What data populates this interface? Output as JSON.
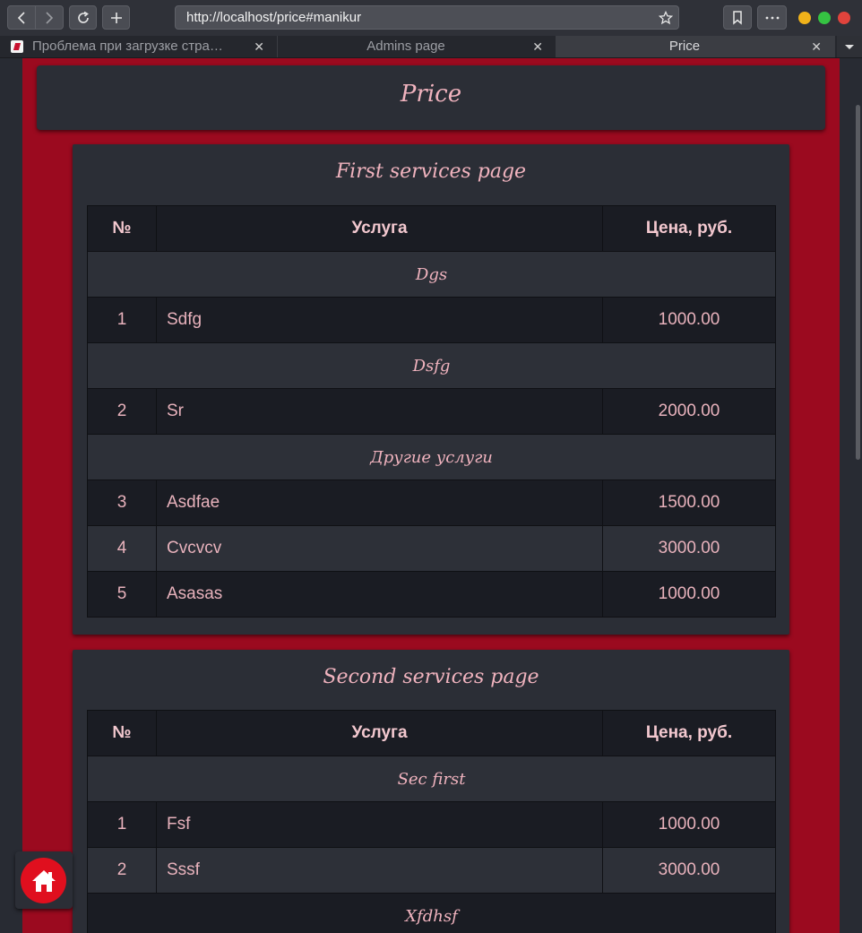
{
  "browser": {
    "url": "http://localhost/price#manikur",
    "tabs": [
      {
        "label": "Проблема при загрузке стра…",
        "close": "✕"
      },
      {
        "label": "Admins page",
        "close": "✕"
      },
      {
        "label": "Price",
        "close": "✕"
      }
    ],
    "window_buttons": {
      "close": "#e0433c",
      "minimize": "#f0b21a",
      "maximize": "#35c342"
    }
  },
  "page": {
    "title": "Price",
    "columns": [
      "№",
      "Услуга",
      "Цена, руб."
    ],
    "sections": [
      {
        "title": "First services page",
        "groups": [
          {
            "name": "Dgs",
            "rows": [
              {
                "num": "1",
                "name": "Sdfg",
                "price": "1000.00"
              }
            ]
          },
          {
            "name": "Dsfg",
            "rows": [
              {
                "num": "2",
                "name": "Sr",
                "price": "2000.00"
              }
            ]
          },
          {
            "name": "Другие услуги",
            "rows": [
              {
                "num": "3",
                "name": "Asdfae",
                "price": "1500.00"
              },
              {
                "num": "4",
                "name": "Cvcvcv",
                "price": "3000.00"
              },
              {
                "num": "5",
                "name": "Asasas",
                "price": "1000.00"
              }
            ]
          }
        ]
      },
      {
        "title": "Second services page",
        "groups": [
          {
            "name": "Sec first",
            "rows": [
              {
                "num": "1",
                "name": "Fsf",
                "price": "1000.00"
              },
              {
                "num": "2",
                "name": "Sssf",
                "price": "3000.00"
              }
            ]
          },
          {
            "name": "Xfdhsf",
            "rows": []
          }
        ]
      }
    ],
    "home_icon": "home-icon",
    "colors": {
      "accent_red": "#9b0a1f",
      "text_pink": "#f0b3be",
      "home_button": "#e00f1e"
    }
  }
}
